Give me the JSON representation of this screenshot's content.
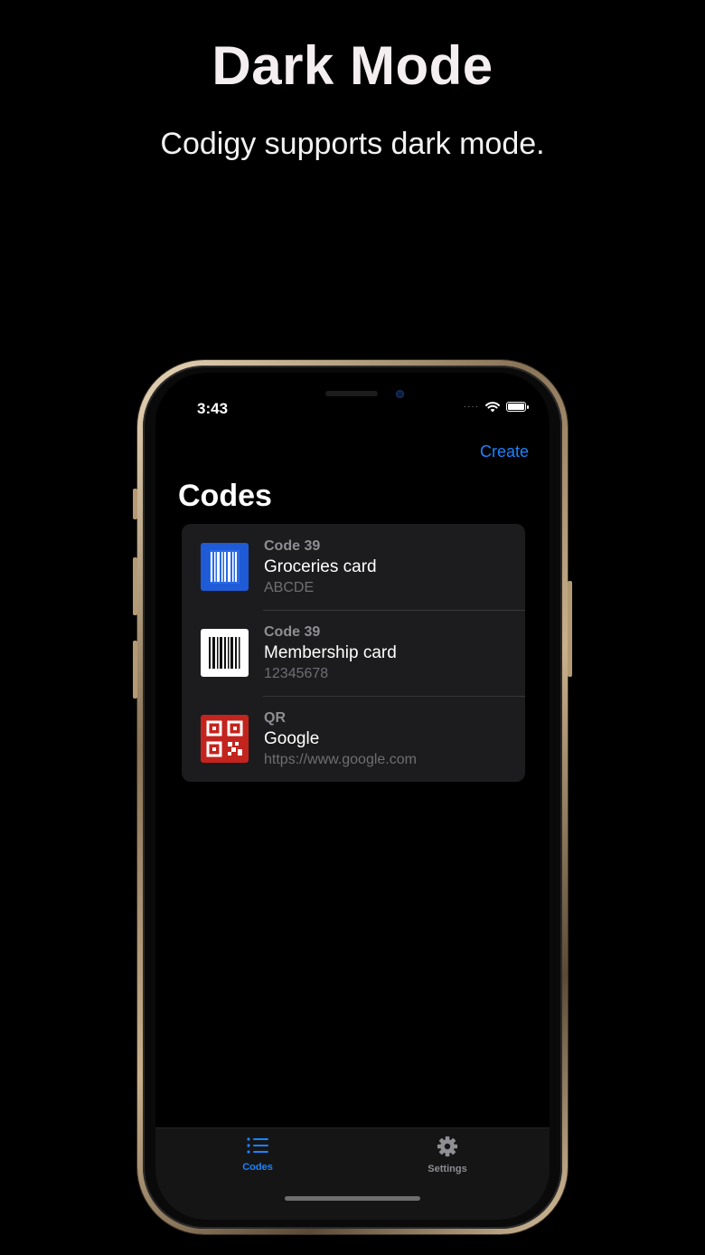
{
  "promo": {
    "title": "Dark Mode",
    "subtitle": "Codigy supports dark mode."
  },
  "status_bar": {
    "time": "3:43",
    "signal": "····",
    "icons": [
      "cellular-signal-icon",
      "wifi-icon",
      "battery-icon"
    ]
  },
  "nav": {
    "create_label": "Create",
    "title": "Codes"
  },
  "codes": [
    {
      "type": "Code 39",
      "name": "Groceries card",
      "value": "ABCDE",
      "icon": "barcode-icon",
      "color": "#1f5bd6"
    },
    {
      "type": "Code 39",
      "name": "Membership card",
      "value": "12345678",
      "icon": "barcode-icon",
      "color": "#ffffff"
    },
    {
      "type": "QR",
      "name": "Google",
      "value": "https://www.google.com",
      "icon": "qr-code-icon",
      "color": "#c3241e"
    }
  ],
  "tab_bar": {
    "tabs": [
      {
        "label": "Codes",
        "icon": "list-icon",
        "selected": true
      },
      {
        "label": "Settings",
        "icon": "gear-icon",
        "selected": false
      }
    ]
  },
  "colors": {
    "accent": "#1a84ff",
    "background": "#000000",
    "cell_background": "#1c1c1e"
  }
}
